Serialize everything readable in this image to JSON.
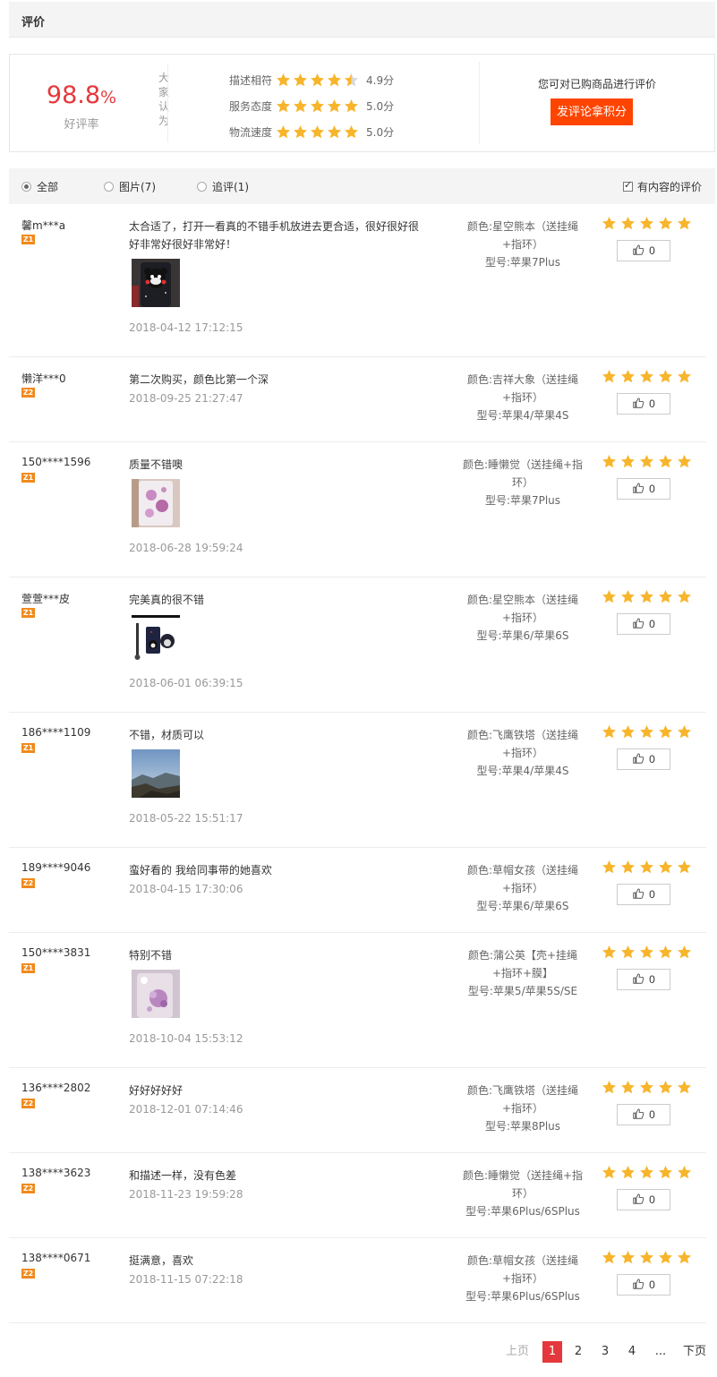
{
  "section": {
    "title": "评价"
  },
  "summary": {
    "rate_value": "98.8",
    "rate_symbol": "%",
    "rate_label": "好评率",
    "people_label": [
      "大",
      "家",
      "认",
      "为"
    ],
    "dimensions": [
      {
        "label": "描述相符",
        "score": "4.9分",
        "stars": 4.5
      },
      {
        "label": "服务态度",
        "score": "5.0分",
        "stars": 5
      },
      {
        "label": "物流速度",
        "score": "5.0分",
        "stars": 5
      }
    ],
    "cta_hint": "您可对已购商品进行评价",
    "cta_button": "发评论拿积分"
  },
  "filters": {
    "all": "全部",
    "pictures": "图片(7)",
    "followup": "追评(1)",
    "with_content": "有内容的评价"
  },
  "colors": {
    "accent": "#e4393c",
    "cta": "#ff4400",
    "star": "#f7b52c",
    "badge": "#f08a1c"
  },
  "reviews": [
    {
      "user": "馨m***a",
      "badge": "Z1",
      "content": "太合适了，打开一看真的不错手机放进去更合适，很好很好很好非常好很好非常好！",
      "image": "bear-case",
      "date": "2018-04-12 17:12:15",
      "sku_line1": "颜色:星空熊本（送挂绳",
      "sku_line2": "+指环）",
      "sku_line3": "型号:苹果7Plus",
      "likes": "0"
    },
    {
      "user": "懒洋***0",
      "badge": "Z2",
      "content": "第二次购买，颜色比第一个深",
      "image": "",
      "date": "2018-09-25 21:27:47",
      "sku_line1": "颜色:吉祥大象（送挂绳",
      "sku_line2": "+指环）",
      "sku_line3": "型号:苹果4/苹果4S",
      "likes": "0"
    },
    {
      "user": "150****1596",
      "badge": "Z1",
      "content": "质量不错噢",
      "image": "flower-case",
      "date": "2018-06-28 19:59:24",
      "sku_line1": "颜色:睡懒觉（送挂绳+指",
      "sku_line2": "环）",
      "sku_line3": "型号:苹果7Plus",
      "likes": "0"
    },
    {
      "user": "萱萱***皮",
      "badge": "Z1",
      "content": "完美真的很不错",
      "image": "bear-set",
      "date": "2018-06-01 06:39:15",
      "sku_line1": "颜色:星空熊本（送挂绳",
      "sku_line2": "+指环）",
      "sku_line3": "型号:苹果6/苹果6S",
      "likes": "0"
    },
    {
      "user": "186****1109",
      "badge": "Z1",
      "content": "不错，材质可以",
      "image": "landscape",
      "date": "2018-05-22 15:51:17",
      "sku_line1": "颜色:飞鹰铁塔（送挂绳",
      "sku_line2": "+指环）",
      "sku_line3": "型号:苹果4/苹果4S",
      "likes": "0"
    },
    {
      "user": "189****9046",
      "badge": "Z2",
      "content": "蛮好看的 我给同事带的她喜欢",
      "image": "",
      "date": "2018-04-15 17:30:06",
      "sku_line1": "颜色:草帽女孩（送挂绳",
      "sku_line2": "+指环）",
      "sku_line3": "型号:苹果6/苹果6S",
      "likes": "0"
    },
    {
      "user": "150****3831",
      "badge": "Z1",
      "content": "特别不错",
      "image": "pink-case",
      "date": "2018-10-04 15:53:12",
      "sku_line1": "颜色:蒲公英【壳+挂绳",
      "sku_line2": "+指环+膜】",
      "sku_line3": "型号:苹果5/苹果5S/SE",
      "likes": "0"
    },
    {
      "user": "136****2802",
      "badge": "Z2",
      "content": "好好好好好",
      "image": "",
      "date": "2018-12-01 07:14:46",
      "sku_line1": "颜色:飞鹰铁塔（送挂绳",
      "sku_line2": "+指环）",
      "sku_line3": "型号:苹果8Plus",
      "likes": "0"
    },
    {
      "user": "138****3623",
      "badge": "Z2",
      "content": "和描述一样，没有色差",
      "image": "",
      "date": "2018-11-23 19:59:28",
      "sku_line1": "颜色:睡懒觉（送挂绳+指",
      "sku_line2": "环）",
      "sku_line3": "型号:苹果6Plus/6SPlus",
      "likes": "0"
    },
    {
      "user": "138****0671",
      "badge": "Z2",
      "content": "挺满意，喜欢",
      "image": "",
      "date": "2018-11-15 07:22:18",
      "sku_line1": "颜色:草帽女孩（送挂绳",
      "sku_line2": "+指环）",
      "sku_line3": "型号:苹果6Plus/6SPlus",
      "likes": "0"
    }
  ],
  "pager": {
    "prev": "上页",
    "pages": [
      "1",
      "2",
      "3",
      "4"
    ],
    "ellipsis": "...",
    "next": "下页",
    "current": "1"
  }
}
